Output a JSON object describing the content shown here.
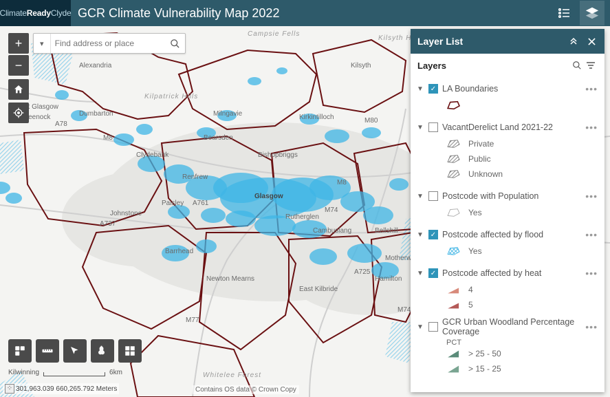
{
  "header": {
    "brand_a": "Climate",
    "brand_b": "Ready",
    "brand_c": "Clyde",
    "title": "GCR Climate Vulnerability Map 2022"
  },
  "search": {
    "placeholder": "Find address or place"
  },
  "scale": {
    "label_left": "Kilwinning",
    "label_right": "6km"
  },
  "coords": {
    "text": "301,963.039 660,265.792 Meters"
  },
  "attribution": {
    "text": "Contains OS data © Crown Copy"
  },
  "panel": {
    "title": "Layer List",
    "subtitle": "Layers",
    "layers": [
      {
        "name": "LA Boundaries",
        "checked": true,
        "expanded": true,
        "legend": [
          {
            "swatch": "boundary",
            "label": ""
          }
        ]
      },
      {
        "name": "VacantDerelict Land 2021-22",
        "checked": false,
        "expanded": true,
        "legend": [
          {
            "swatch": "hatch-grey",
            "label": "Private"
          },
          {
            "swatch": "hatch-grey",
            "label": "Public"
          },
          {
            "swatch": "hatch-grey",
            "label": "Unknown"
          }
        ]
      },
      {
        "name": "Postcode with Population",
        "checked": false,
        "expanded": true,
        "legend": [
          {
            "swatch": "poly-grey",
            "label": "Yes"
          }
        ]
      },
      {
        "name": "Postcode affected by flood",
        "checked": true,
        "expanded": true,
        "legend": [
          {
            "swatch": "crosshatch-blue",
            "label": "Yes"
          }
        ]
      },
      {
        "name": "Postcode affected by heat",
        "checked": true,
        "expanded": true,
        "legend": [
          {
            "swatch": "heat-4",
            "label": "4"
          },
          {
            "swatch": "heat-5",
            "label": "5"
          }
        ]
      },
      {
        "name": "GCR Urban Woodland Percentage Coverage",
        "checked": false,
        "expanded": true,
        "note": "PCT",
        "legend": [
          {
            "swatch": "pct-25-50",
            "label": "> 25 - 50"
          },
          {
            "swatch": "pct-15-25",
            "label": "> 15 - 25"
          }
        ]
      }
    ]
  },
  "map_labels": {
    "p0": "Campsie Fells",
    "p1": "Alexandria",
    "p2": "Dumbarton",
    "p3": "Kilpatrick Hills",
    "p4": "Milngavie",
    "p5": "Bearsden",
    "p6": "Kirkintilloch",
    "p7": "Kilsyth",
    "p8": "Kilsyth Hills",
    "p9": "Bishopbriggs",
    "p10": "Clydebank",
    "p11": "Glasgow",
    "p12": "Renfrew",
    "p13": "Paisley",
    "p14": "Johnstone",
    "p15": "Barrhead",
    "p16": "Newton Mearns",
    "p17": "East Kilbride",
    "p18": "Cambuslang",
    "p19": "Rutherglen",
    "p20": "Hamilton",
    "p21": "Motherwell",
    "p22": "Bellshill",
    "p23": "Whitelee Forest",
    "p24": "Greenock",
    "p25": "A78",
    "p26": "A737",
    "p27": "M8",
    "p28": "M77",
    "p29": "M80",
    "p30": "M74",
    "p31": "A725",
    "p32": "A761",
    "p33": "M74",
    "p34": "M8",
    "p35": "Port Glasgow"
  }
}
